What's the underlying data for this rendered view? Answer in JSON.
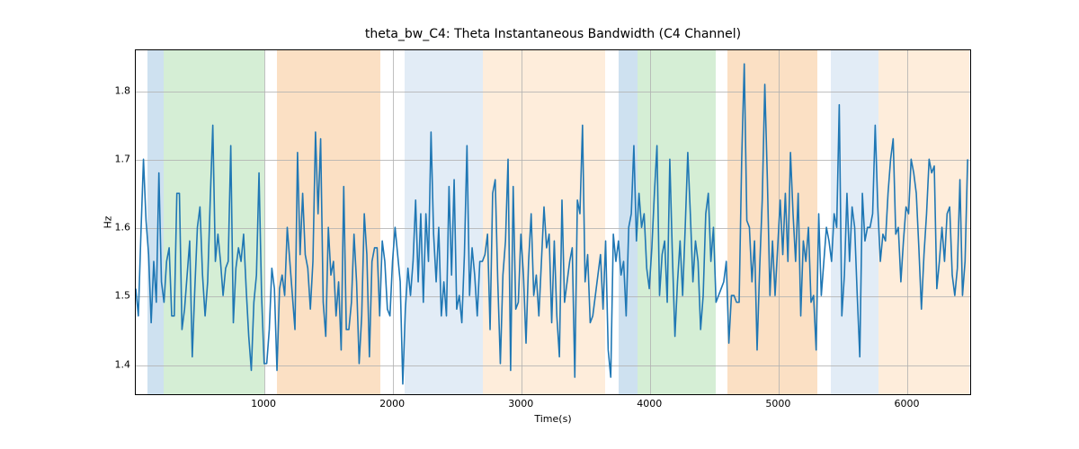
{
  "chart_data": {
    "type": "line",
    "title": "theta_bw_C4: Theta Instantaneous Bandwidth (C4 Channel)",
    "xlabel": "Time(s)",
    "ylabel": "Hz",
    "xlim": [
      0,
      6500
    ],
    "ylim": [
      1.355,
      1.86
    ],
    "xticks": [
      1000,
      2000,
      3000,
      4000,
      5000,
      6000
    ],
    "yticks": [
      1.4,
      1.5,
      1.6,
      1.7,
      1.8
    ],
    "xtick_labels": [
      "1000",
      "2000",
      "3000",
      "4000",
      "5000",
      "6000"
    ],
    "ytick_labels": [
      "1.4",
      "1.5",
      "1.6",
      "1.7",
      "1.8"
    ],
    "bands": [
      {
        "x0": 90,
        "x1": 220,
        "color": "#a6c8e4",
        "alpha": 0.55
      },
      {
        "x0": 220,
        "x1": 1000,
        "color": "#b3e0b3",
        "alpha": 0.55
      },
      {
        "x0": 1100,
        "x1": 1900,
        "color": "#f7c793",
        "alpha": 0.55
      },
      {
        "x0": 2090,
        "x1": 2700,
        "color": "#cfdff0",
        "alpha": 0.6
      },
      {
        "x0": 2700,
        "x1": 3650,
        "color": "#fde5cc",
        "alpha": 0.7
      },
      {
        "x0": 3750,
        "x1": 3900,
        "color": "#a6c8e4",
        "alpha": 0.55
      },
      {
        "x0": 3900,
        "x1": 4510,
        "color": "#b3e0b3",
        "alpha": 0.55
      },
      {
        "x0": 4600,
        "x1": 5300,
        "color": "#f7c793",
        "alpha": 0.55
      },
      {
        "x0": 5400,
        "x1": 5770,
        "color": "#cfdff0",
        "alpha": 0.6
      },
      {
        "x0": 5770,
        "x1": 6480,
        "color": "#fde5cc",
        "alpha": 0.7
      }
    ],
    "x": [
      0,
      20,
      40,
      60,
      80,
      100,
      120,
      140,
      160,
      180,
      200,
      220,
      240,
      260,
      280,
      300,
      320,
      340,
      360,
      380,
      400,
      420,
      440,
      460,
      480,
      500,
      520,
      540,
      560,
      580,
      600,
      620,
      640,
      660,
      680,
      700,
      720,
      740,
      760,
      780,
      800,
      820,
      840,
      860,
      880,
      900,
      920,
      940,
      960,
      980,
      1000,
      1020,
      1040,
      1060,
      1080,
      1100,
      1120,
      1140,
      1160,
      1180,
      1200,
      1220,
      1240,
      1260,
      1280,
      1300,
      1320,
      1340,
      1360,
      1380,
      1400,
      1420,
      1440,
      1460,
      1480,
      1500,
      1520,
      1540,
      1560,
      1580,
      1600,
      1620,
      1640,
      1660,
      1680,
      1700,
      1720,
      1740,
      1760,
      1780,
      1800,
      1820,
      1840,
      1860,
      1880,
      1900,
      1920,
      1940,
      1960,
      1980,
      2000,
      2020,
      2040,
      2060,
      2080,
      2100,
      2120,
      2140,
      2160,
      2180,
      2200,
      2220,
      2240,
      2260,
      2280,
      2300,
      2320,
      2340,
      2360,
      2380,
      2400,
      2420,
      2440,
      2460,
      2480,
      2500,
      2520,
      2540,
      2560,
      2580,
      2600,
      2620,
      2640,
      2660,
      2680,
      2700,
      2720,
      2740,
      2760,
      2780,
      2800,
      2820,
      2840,
      2860,
      2880,
      2900,
      2920,
      2940,
      2960,
      2980,
      3000,
      3020,
      3040,
      3060,
      3080,
      3100,
      3120,
      3140,
      3160,
      3180,
      3200,
      3220,
      3240,
      3260,
      3280,
      3300,
      3320,
      3340,
      3360,
      3380,
      3400,
      3420,
      3440,
      3460,
      3480,
      3500,
      3520,
      3540,
      3560,
      3580,
      3600,
      3620,
      3640,
      3660,
      3680,
      3700,
      3720,
      3740,
      3760,
      3780,
      3800,
      3820,
      3840,
      3860,
      3880,
      3900,
      3920,
      3940,
      3960,
      3980,
      4000,
      4020,
      4040,
      4060,
      4080,
      4100,
      4120,
      4140,
      4160,
      4180,
      4200,
      4220,
      4240,
      4260,
      4280,
      4300,
      4320,
      4340,
      4360,
      4380,
      4400,
      4420,
      4440,
      4460,
      4480,
      4500,
      4520,
      4540,
      4560,
      4580,
      4600,
      4620,
      4640,
      4660,
      4680,
      4700,
      4720,
      4740,
      4760,
      4780,
      4800,
      4820,
      4840,
      4860,
      4880,
      4900,
      4920,
      4940,
      4960,
      4980,
      5000,
      5020,
      5040,
      5060,
      5080,
      5100,
      5120,
      5140,
      5160,
      5180,
      5200,
      5220,
      5240,
      5260,
      5280,
      5300,
      5320,
      5340,
      5360,
      5380,
      5400,
      5420,
      5440,
      5460,
      5480,
      5500,
      5520,
      5540,
      5560,
      5580,
      5600,
      5620,
      5640,
      5660,
      5680,
      5700,
      5720,
      5740,
      5760,
      5780,
      5800,
      5820,
      5840,
      5860,
      5880,
      5900,
      5920,
      5940,
      5960,
      5980,
      6000,
      6020,
      6040,
      6060,
      6080,
      6100,
      6120,
      6140,
      6160,
      6180,
      6200,
      6220,
      6240,
      6260,
      6280,
      6300,
      6320,
      6340,
      6360,
      6380,
      6400,
      6420,
      6440,
      6460,
      6480
    ],
    "y": [
      1.51,
      1.47,
      1.59,
      1.7,
      1.61,
      1.56,
      1.46,
      1.55,
      1.49,
      1.68,
      1.52,
      1.49,
      1.55,
      1.57,
      1.47,
      1.47,
      1.65,
      1.65,
      1.45,
      1.48,
      1.53,
      1.58,
      1.41,
      1.51,
      1.6,
      1.63,
      1.53,
      1.47,
      1.52,
      1.64,
      1.75,
      1.55,
      1.59,
      1.55,
      1.5,
      1.54,
      1.55,
      1.72,
      1.46,
      1.54,
      1.57,
      1.55,
      1.59,
      1.51,
      1.44,
      1.39,
      1.49,
      1.53,
      1.68,
      1.5,
      1.4,
      1.4,
      1.45,
      1.54,
      1.51,
      1.39,
      1.51,
      1.53,
      1.5,
      1.6,
      1.55,
      1.5,
      1.45,
      1.71,
      1.56,
      1.65,
      1.56,
      1.54,
      1.48,
      1.55,
      1.74,
      1.62,
      1.73,
      1.49,
      1.44,
      1.6,
      1.53,
      1.55,
      1.47,
      1.52,
      1.42,
      1.66,
      1.45,
      1.45,
      1.49,
      1.59,
      1.52,
      1.4,
      1.47,
      1.62,
      1.56,
      1.41,
      1.55,
      1.57,
      1.57,
      1.47,
      1.58,
      1.55,
      1.48,
      1.47,
      1.55,
      1.6,
      1.56,
      1.52,
      1.37,
      1.48,
      1.54,
      1.5,
      1.55,
      1.64,
      1.52,
      1.62,
      1.49,
      1.62,
      1.55,
      1.74,
      1.59,
      1.52,
      1.6,
      1.47,
      1.52,
      1.47,
      1.66,
      1.53,
      1.67,
      1.48,
      1.5,
      1.46,
      1.56,
      1.72,
      1.5,
      1.57,
      1.53,
      1.47,
      1.55,
      1.55,
      1.56,
      1.59,
      1.45,
      1.65,
      1.67,
      1.52,
      1.4,
      1.53,
      1.58,
      1.7,
      1.39,
      1.66,
      1.48,
      1.49,
      1.59,
      1.53,
      1.43,
      1.55,
      1.62,
      1.5,
      1.53,
      1.47,
      1.55,
      1.63,
      1.57,
      1.59,
      1.46,
      1.58,
      1.47,
      1.41,
      1.64,
      1.49,
      1.52,
      1.55,
      1.57,
      1.38,
      1.64,
      1.62,
      1.75,
      1.52,
      1.56,
      1.46,
      1.47,
      1.5,
      1.53,
      1.56,
      1.48,
      1.58,
      1.42,
      1.38,
      1.59,
      1.55,
      1.58,
      1.53,
      1.55,
      1.47,
      1.6,
      1.62,
      1.72,
      1.58,
      1.65,
      1.6,
      1.62,
      1.54,
      1.51,
      1.57,
      1.65,
      1.72,
      1.5,
      1.56,
      1.58,
      1.49,
      1.7,
      1.56,
      1.44,
      1.52,
      1.58,
      1.5,
      1.6,
      1.71,
      1.62,
      1.52,
      1.58,
      1.55,
      1.45,
      1.5,
      1.62,
      1.65,
      1.55,
      1.6,
      1.49,
      1.5,
      1.51,
      1.52,
      1.55,
      1.43,
      1.5,
      1.5,
      1.49,
      1.49,
      1.7,
      1.84,
      1.61,
      1.6,
      1.52,
      1.58,
      1.42,
      1.54,
      1.64,
      1.81,
      1.67,
      1.5,
      1.58,
      1.5,
      1.57,
      1.64,
      1.56,
      1.65,
      1.55,
      1.71,
      1.62,
      1.55,
      1.65,
      1.47,
      1.58,
      1.55,
      1.6,
      1.49,
      1.5,
      1.42,
      1.62,
      1.5,
      1.55,
      1.6,
      1.58,
      1.55,
      1.62,
      1.6,
      1.78,
      1.47,
      1.53,
      1.65,
      1.55,
      1.63,
      1.6,
      1.5,
      1.41,
      1.65,
      1.58,
      1.6,
      1.6,
      1.62,
      1.75,
      1.63,
      1.55,
      1.59,
      1.58,
      1.65,
      1.7,
      1.73,
      1.59,
      1.6,
      1.52,
      1.58,
      1.63,
      1.62,
      1.7,
      1.68,
      1.65,
      1.57,
      1.48,
      1.56,
      1.62,
      1.7,
      1.68,
      1.69,
      1.51,
      1.55,
      1.6,
      1.55,
      1.62,
      1.63,
      1.53,
      1.5,
      1.54,
      1.67,
      1.5,
      1.55,
      1.7,
      1.55
    ]
  }
}
